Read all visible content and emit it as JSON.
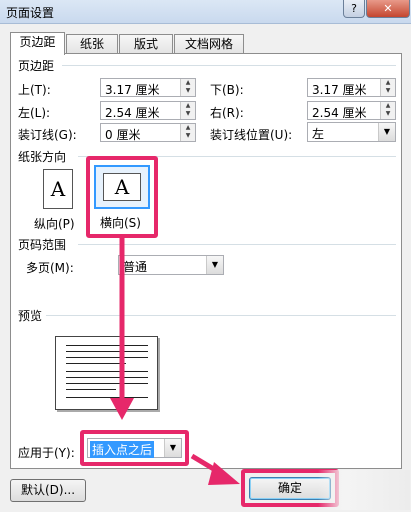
{
  "dialog": {
    "title": "页面设置",
    "help_glyph": "?",
    "close_glyph": "✕"
  },
  "tabs": [
    {
      "label": "页边距",
      "active": true
    },
    {
      "label": "纸张",
      "active": false
    },
    {
      "label": "版式",
      "active": false
    },
    {
      "label": "文档网格",
      "active": false
    }
  ],
  "margins": {
    "section_title": "页边距",
    "top": {
      "label": "上(T):",
      "value": "3.17 厘米"
    },
    "bottom": {
      "label": "下(B):",
      "value": "3.17 厘米"
    },
    "left": {
      "label": "左(L):",
      "value": "2.54 厘米"
    },
    "right": {
      "label": "右(R):",
      "value": "2.54 厘米"
    },
    "gutter": {
      "label": "装订线(G):",
      "value": "0 厘米"
    },
    "gutter_position": {
      "label": "装订线位置(U):",
      "value": "左"
    }
  },
  "orientation": {
    "section_title": "纸张方向",
    "portrait_label": "纵向(P)",
    "landscape_label": "横向(S)",
    "selected": "landscape",
    "glyph": "A"
  },
  "pages": {
    "section_title": "页码范围",
    "multiple_label": "多页(M):",
    "multiple_value": "普通"
  },
  "preview": {
    "section_title": "预览",
    "apply_label": "应用于(Y):",
    "apply_value": "插入点之后"
  },
  "buttons": {
    "default_label": "默认(D)...",
    "ok_label": "确定"
  },
  "colors": {
    "highlight": "#e6286a",
    "selection": "#3399ff"
  }
}
